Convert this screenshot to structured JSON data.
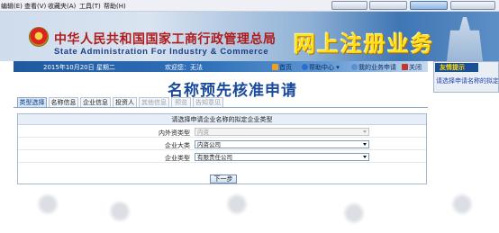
{
  "menubar": {
    "items": [
      "编辑(E)",
      "查看(V)",
      "收藏夹(A)",
      "工具(T)",
      "帮助(H)"
    ]
  },
  "banner": {
    "cn_title": "中华人民共和国国家工商行政管理总局",
    "en_title": "State Administration For Industry & Commerce",
    "slogan": "网上注册业务"
  },
  "infobar": {
    "date": "2015年10月20日 星期二",
    "welcome": "欢迎您：无法",
    "links": [
      "首页",
      "帮助中心 ▾",
      "我的业务申请",
      "关闭"
    ]
  },
  "tip": {
    "title": "友情提示",
    "text": "请选择申请名称的拟定"
  },
  "page_title": "名称预先核准申请",
  "tabs": [
    {
      "label": "类型选择",
      "state": "active"
    },
    {
      "label": "名称信息",
      "state": "normal"
    },
    {
      "label": "企业信息",
      "state": "normal"
    },
    {
      "label": "投资人",
      "state": "normal"
    },
    {
      "label": "其他信息",
      "state": "disabled"
    },
    {
      "label": "预览",
      "state": "disabled"
    },
    {
      "label": "告知意见",
      "state": "disabled"
    }
  ],
  "form": {
    "heading": "请选择申请企业名称的拟定企业类型",
    "rows": [
      {
        "label": "内外资类型",
        "value": "内资",
        "disabled": true
      },
      {
        "label": "企业大类",
        "value": "内资公司",
        "disabled": false
      },
      {
        "label": "企业类型",
        "value": "有限责任公司",
        "disabled": false
      }
    ],
    "next_label": "下一步"
  },
  "colors": {
    "title_blue": "#1a4a9c",
    "banner_red": "#b11b1b",
    "slogan_yellow": "#ffe11a",
    "infobar_blue": "#1f5aa0"
  }
}
